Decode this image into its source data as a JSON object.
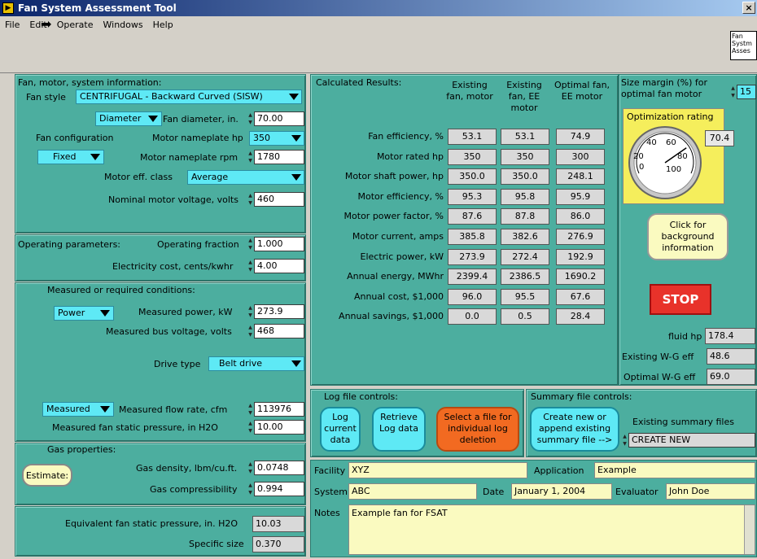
{
  "window": {
    "title": "Fan System Assessment Tool",
    "close": "×",
    "icon_letter": "▶"
  },
  "menu": [
    "File",
    "Edit",
    "Operate",
    "Windows",
    "Help"
  ],
  "vi_icon_text": "Fan Systm Asses",
  "fan_motor": {
    "header": "Fan, motor, system information:",
    "fan_style_label": "Fan style",
    "fan_style": "CENTRIFUGAL - Backward Curved (SISW)",
    "diameter_mode": "Diameter",
    "fan_diameter_label": "Fan diameter, in.",
    "fan_diameter": "70.00",
    "fan_config_label": "Fan configuration",
    "motor_hp_label": "Motor nameplate hp",
    "motor_hp": "350",
    "config_value": "Fixed",
    "motor_rpm_label": "Motor nameplate rpm",
    "motor_rpm": "1780",
    "eff_class_label": "Motor eff. class",
    "eff_class": "Average",
    "voltage_label": "Nominal motor voltage, volts",
    "voltage": "460"
  },
  "operating": {
    "header": "Operating parameters:",
    "fraction_label": "Operating fraction",
    "fraction": "1.000",
    "cost_label": "Electricity cost, cents/kwhr",
    "cost": "4.00"
  },
  "measured": {
    "header": "Measured or required conditions:",
    "power_mode": "Power",
    "power_label": "Measured power, kW",
    "power": "273.9",
    "bus_label": "Measured bus voltage, volts",
    "bus": "468",
    "drive_label": "Drive type",
    "drive": "Belt drive",
    "flow_mode": "Measured",
    "flow_label": "Measured flow rate, cfm",
    "flow": "113976",
    "static_label": "Measured fan static pressure, in H2O",
    "static": "10.00"
  },
  "gas": {
    "header": "Gas properties:",
    "estimate": "Estimate:",
    "density_label": "Gas density, lbm/cu.ft.",
    "density": "0.0748",
    "compress_label": "Gas compressibility",
    "compress": "0.994"
  },
  "equiv": {
    "static_label": "Equivalent fan static pressure, in. H2O",
    "static": "10.03",
    "size_label": "Specific size",
    "size": "0.370"
  },
  "results": {
    "header": "Calculated Results:",
    "columns": [
      "Existing fan, motor",
      "Existing fan, EE motor",
      "Optimal fan, EE motor"
    ],
    "rows": [
      {
        "label": "Fan efficiency, %",
        "values": [
          "53.1",
          "53.1",
          "74.9"
        ]
      },
      {
        "label": "Motor rated hp",
        "values": [
          "350",
          "350",
          "300"
        ]
      },
      {
        "label": "Motor shaft power, hp",
        "values": [
          "350.0",
          "350.0",
          "248.1"
        ]
      },
      {
        "label": "Motor efficiency, %",
        "values": [
          "95.3",
          "95.8",
          "95.9"
        ]
      },
      {
        "label": "Motor power factor, %",
        "values": [
          "87.6",
          "87.8",
          "86.0"
        ]
      },
      {
        "label": "Motor current, amps",
        "values": [
          "385.8",
          "382.6",
          "276.9"
        ]
      },
      {
        "label": "Electric power, kW",
        "values": [
          "273.9",
          "272.4",
          "192.9"
        ]
      },
      {
        "label": "Annual energy, MWhr",
        "values": [
          "2399.4",
          "2386.5",
          "1690.2"
        ]
      },
      {
        "label": "Annual cost, $1,000",
        "values": [
          "96.0",
          "95.5",
          "67.6"
        ]
      },
      {
        "label": "Annual savings, $1,000",
        "values": [
          "0.0",
          "0.5",
          "28.4"
        ]
      }
    ]
  },
  "side": {
    "margin_label": "Size margin (%) for optimal fan motor",
    "margin": "15",
    "opt_label": "Optimization rating",
    "opt_value": "70.4",
    "opt_fraction": 0.704,
    "gauge_ticks": [
      "0",
      "20",
      "40",
      "60",
      "80",
      "100"
    ],
    "bg_button": "Click for background information",
    "stop": "STOP",
    "fluid_label": "fluid hp",
    "fluid": "178.4",
    "exist_wg_label": "Existing W-G eff",
    "exist_wg": "48.6",
    "opt_wg_label": "Optimal W-G eff",
    "opt_wg": "69.0"
  },
  "log": {
    "header": "Log file controls:",
    "log_current": "Log current data",
    "retrieve": "Retrieve Log data",
    "select": "Select a file for individual log deletion"
  },
  "summary": {
    "header": "Summary file controls:",
    "create": "Create new or append existing summary file -->",
    "existing_label": "Existing summary files",
    "existing": "CREATE NEW"
  },
  "info": {
    "facility_label": "Facility",
    "facility": "XYZ",
    "application_label": "Application",
    "application": "Example",
    "system_label": "System",
    "system": "ABC",
    "date_label": "Date",
    "date": "January 1, 2004",
    "evaluator_label": "Evaluator",
    "evaluator": "John Doe",
    "notes_label": "Notes",
    "notes": "Example fan for FSAT"
  },
  "colors": {
    "panel": "#4cae9f",
    "dropdown": "#5ee9f5",
    "stop": "#e8322a",
    "select_btn": "#f26a21",
    "gauge_bg": "#f5ee5c"
  }
}
